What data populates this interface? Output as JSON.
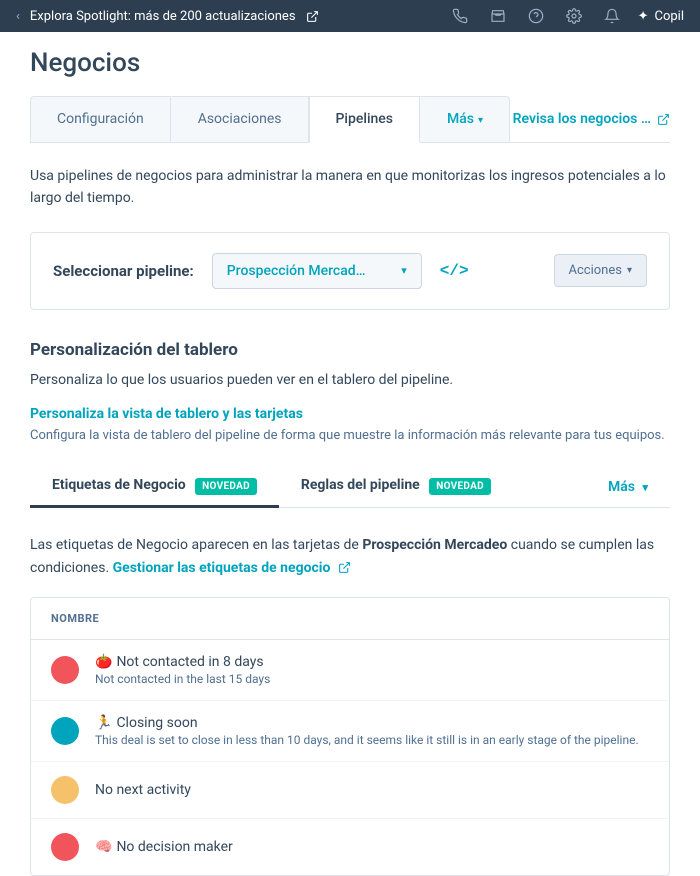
{
  "topbar": {
    "spotlight": "Explora Spotlight: más de 200 actualizaciones",
    "copilot": "Copil"
  },
  "page_title": "Negocios",
  "tabs": {
    "config": "Configuración",
    "assoc": "Asociaciones",
    "pipelines": "Pipelines",
    "more": "Más",
    "review": "Revisa los negocios …"
  },
  "description": "Usa pipelines de negocios para administrar la manera en que monitorizas los ingresos potenciales a lo largo del tiempo.",
  "selector": {
    "label": "Seleccionar pipeline:",
    "value": "Prospección Mercad…",
    "actions": "Acciones"
  },
  "customization": {
    "heading": "Personalización del tablero",
    "sub": "Personaliza lo que los usuarios pueden ver en el tablero del pipeline.",
    "link_title": "Personaliza la vista de tablero y las tarjetas",
    "link_desc": "Configura la vista de tablero del pipeline de forma que muestre la información más relevante para tus equipos."
  },
  "subtabs": {
    "labels": "Etiquetas de Negocio",
    "rules": "Reglas del pipeline",
    "badge": "NOVEDAD",
    "more": "Más"
  },
  "labels_section": {
    "pre": "Las etiquetas de Negocio aparecen en las tarjetas de ",
    "bold": "Prospección Mercadeo",
    "post": " cuando se cumplen las condiciones. ",
    "manage": "Gestionar las etiquetas de negocio",
    "header": "NOMBRE"
  },
  "labels": [
    {
      "color": "#f2545b",
      "emoji": "🍅",
      "title": "Not contacted in 8 days",
      "sub": "Not contacted in the last 15 days"
    },
    {
      "color": "#00a4bd",
      "emoji": "🏃",
      "title": "Closing soon",
      "sub": "This deal is set to close in less than 10 days, and it seems like it still is in an early stage of the pipeline."
    },
    {
      "color": "#f5c26b",
      "emoji": "",
      "title": "No next activity",
      "sub": ""
    },
    {
      "color": "#f2545b",
      "emoji": "🧠",
      "title": "No decision maker",
      "sub": ""
    }
  ]
}
